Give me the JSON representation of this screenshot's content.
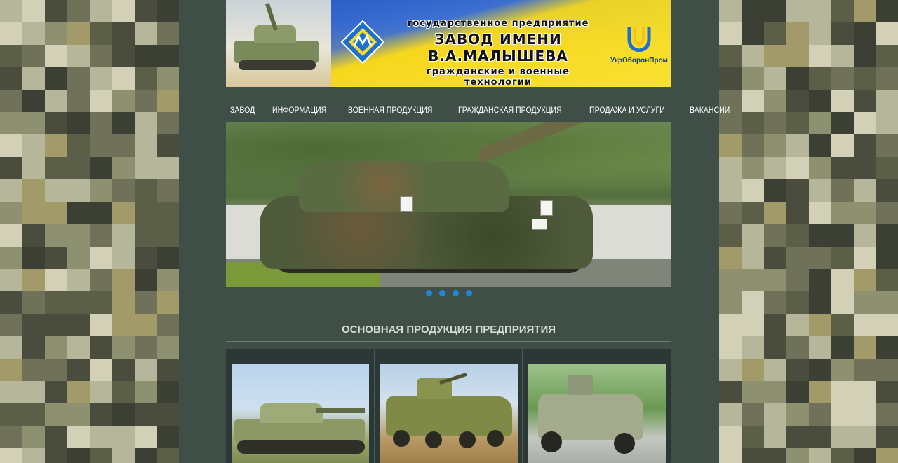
{
  "banner": {
    "line1": "государственное   предприятие",
    "line2": "ЗАВОД  ИМЕНИ  В.А.МАЛЫШЕВА",
    "line3": "гражданские  и  военные  технологии",
    "partner_logo_text": "УкрОборонПром"
  },
  "nav": {
    "items": [
      {
        "label": "ЗАВОД"
      },
      {
        "label": "ИНФОРМАЦИЯ"
      },
      {
        "label": "ВОЕННАЯ ПРОДУКЦИЯ"
      },
      {
        "label": "ГРАЖДАНСКАЯ ПРОДУКЦИЯ"
      },
      {
        "label": "ПРОДАЖА И УСЛУГИ"
      },
      {
        "label": "ВАКАНСИИ"
      }
    ]
  },
  "slider": {
    "slide_count": 4,
    "dot_color": "#1e88d8"
  },
  "section": {
    "title": "ОСНОВНАЯ ПРОДУКЦИЯ ПРЕДПРИЯТИЯ"
  },
  "colors": {
    "page_bg": "#3f4f47",
    "products_bg": "#2c3836",
    "nav_text": "#ffffff"
  }
}
